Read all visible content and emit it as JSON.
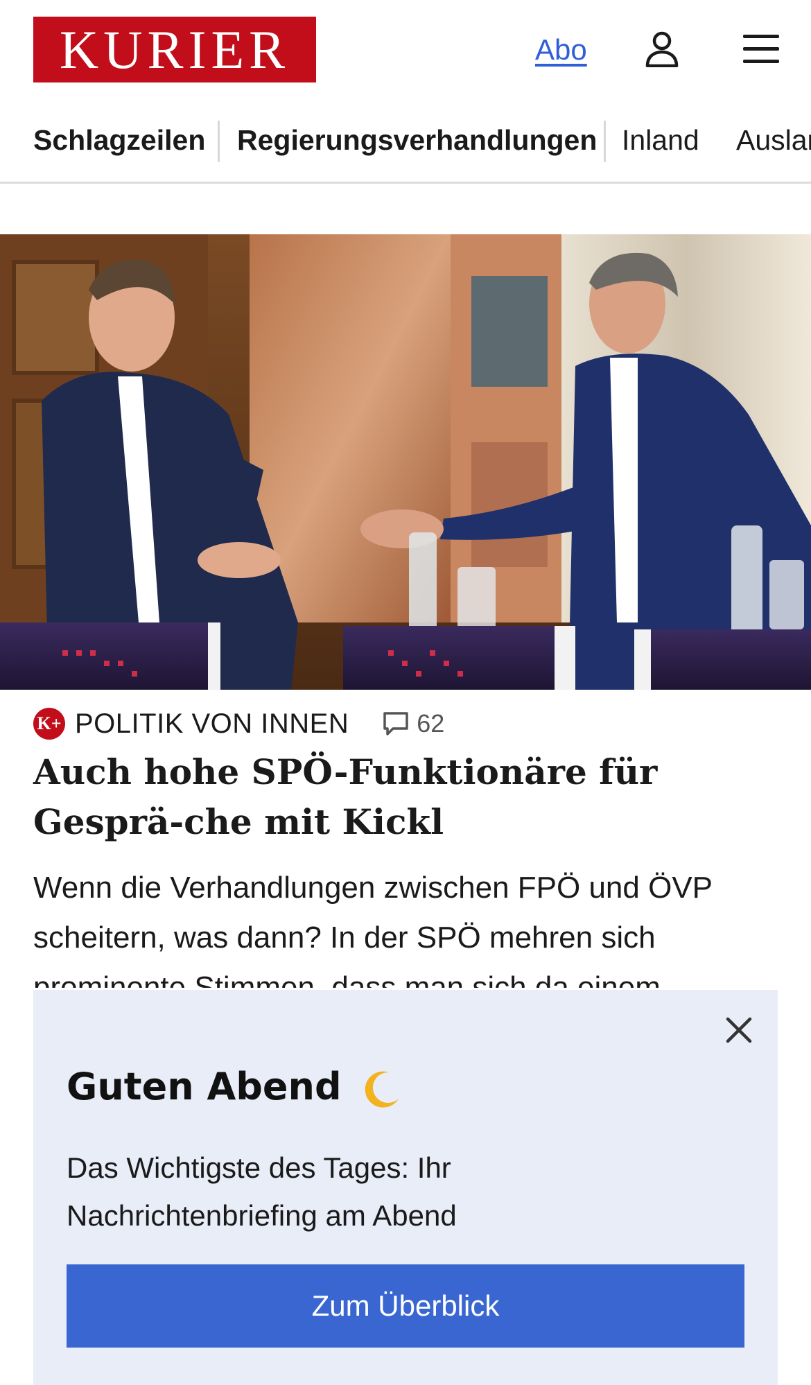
{
  "header": {
    "logo_text": "KURIER",
    "abo_label": "Abo",
    "icons": {
      "account": "user-icon",
      "menu": "hamburger-menu-icon"
    },
    "brand_color": "#c20e1a"
  },
  "nav": {
    "items": [
      {
        "label": "Schlagzeilen"
      },
      {
        "label": "Regierungsverhandlungen"
      },
      {
        "label": "Inland"
      },
      {
        "label": "Ausland"
      }
    ]
  },
  "article": {
    "image_alt": "Zwei Politiker reichen sich die Hand",
    "section_badge": "K+",
    "section_label": "POLITIK VON INNEN",
    "comment_count": "62",
    "headline": "Auch hohe SPÖ-Funktionäre für Gesprä-che mit Kickl",
    "teaser": "Wenn die Verhandlungen zwischen FPÖ und ÖVP scheitern, was dann? In der SPÖ mehren sich prominente Stimmen, dass man sich da einem"
  },
  "popup": {
    "title": "Guten Abend",
    "text": "Das Wichtigste des Tages: Ihr Nachrichtenbriefing am Abend",
    "button_label": "Zum Überblick",
    "accent_color": "#3a66d2",
    "background_color": "#e9edf8"
  }
}
